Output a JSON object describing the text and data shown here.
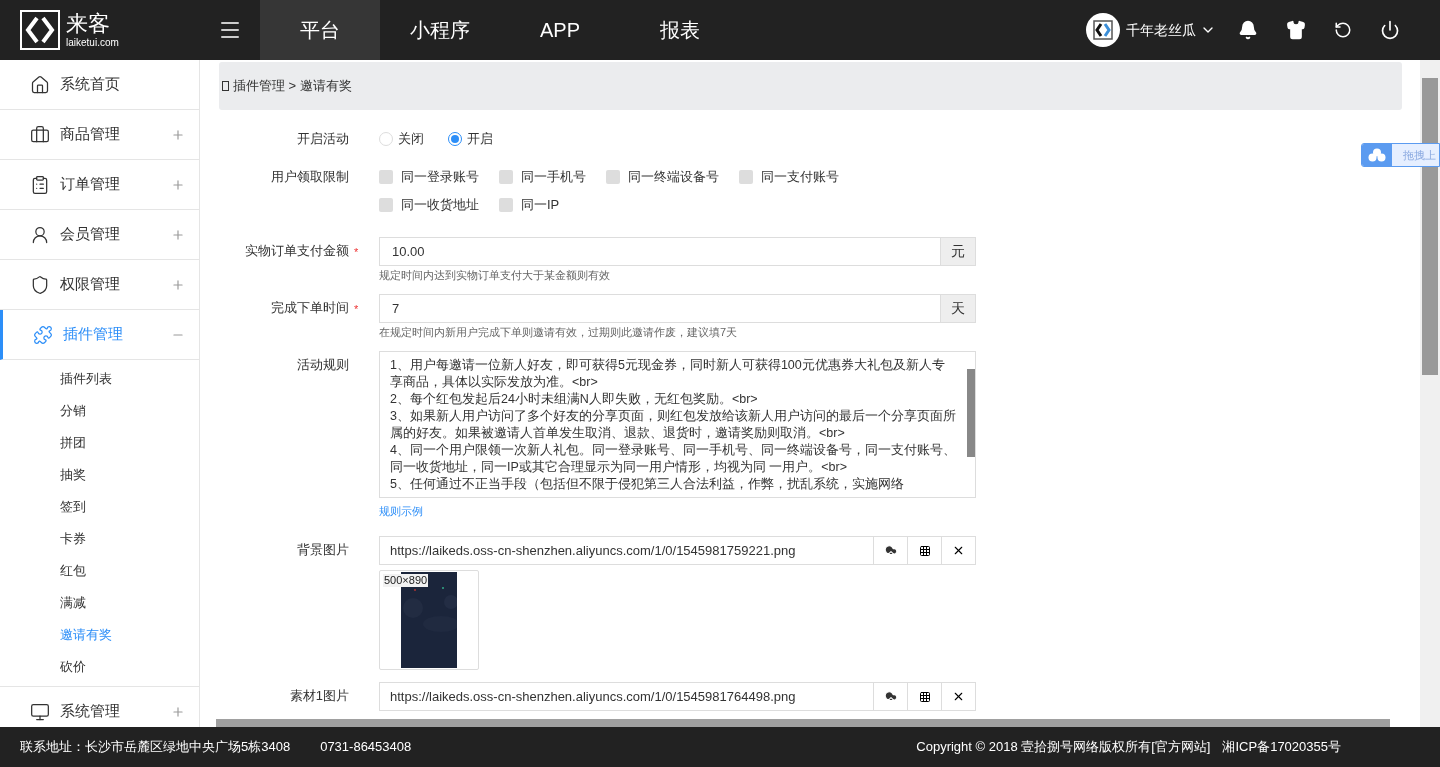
{
  "header": {
    "logo": {
      "name": "来客",
      "domain": "laiketui.com"
    },
    "nav": [
      {
        "label": "平台",
        "selected": true
      },
      {
        "label": "小程序",
        "selected": false
      },
      {
        "label": "APP",
        "selected": false
      },
      {
        "label": "报表",
        "selected": false
      }
    ],
    "user": {
      "name": "千年老丝瓜"
    }
  },
  "sidebar": {
    "items": [
      {
        "label": "系统首页",
        "kind": "link",
        "selected": false
      },
      {
        "label": "商品管理",
        "kind": "group",
        "expanded": false,
        "selected": false
      },
      {
        "label": "订单管理",
        "kind": "group",
        "expanded": false,
        "selected": false
      },
      {
        "label": "会员管理",
        "kind": "group",
        "expanded": false,
        "selected": false
      },
      {
        "label": "权限管理",
        "kind": "group",
        "expanded": false,
        "selected": false
      },
      {
        "label": "插件管理",
        "kind": "group",
        "expanded": true,
        "selected": true,
        "children": [
          {
            "label": "插件列表",
            "selected": false
          },
          {
            "label": "分销",
            "selected": false
          },
          {
            "label": "拼团",
            "selected": false
          },
          {
            "label": "抽奖",
            "selected": false
          },
          {
            "label": "签到",
            "selected": false
          },
          {
            "label": "卡券",
            "selected": false
          },
          {
            "label": "红包",
            "selected": false
          },
          {
            "label": "满减",
            "selected": false
          },
          {
            "label": "邀请有奖",
            "selected": true
          },
          {
            "label": "砍价",
            "selected": false
          }
        ]
      },
      {
        "label": "系统管理",
        "kind": "group",
        "expanded": false,
        "selected": false
      }
    ]
  },
  "breadcrumb": "插件管理 > 邀请有奖",
  "form": [
    {
      "kind": "radio",
      "label": "开启活动",
      "options": [
        {
          "label": "关闭",
          "selected": false
        },
        {
          "label": "开启",
          "selected": true
        }
      ]
    },
    {
      "kind": "checkbox",
      "label": "用户领取限制",
      "options": [
        {
          "label": "同一登录账号",
          "checked": false
        },
        {
          "label": "同一手机号",
          "checked": false
        },
        {
          "label": "同一终端设备号",
          "checked": false
        },
        {
          "label": "同一支付账号",
          "checked": false
        },
        {
          "label": "同一收货地址",
          "checked": false
        },
        {
          "label": "同一IP",
          "checked": false
        }
      ]
    },
    {
      "kind": "input",
      "label": "实物订单支付金额",
      "required_mark": "*",
      "value": "10.00",
      "unit": "元",
      "hint": "规定时间内达到实物订单支付大于某金额则有效"
    },
    {
      "kind": "input",
      "label": "完成下单时间",
      "required_mark": "*",
      "value": "7",
      "unit": "天",
      "hint": "在规定时间内新用户完成下单则邀请有效，过期则此邀请作废，建议填7天"
    },
    {
      "kind": "textarea",
      "label": "活动规则",
      "value": "1、用户每邀请一位新人好友，即可获得5元现金券，同时新人可获得100元优惠券大礼包及新人专享商品，具体以实际发放为准。<br>\n2、每个红包发起后24小时未组满N人即失败，无红包奖励。<br>\n3、如果新人用户访问了多个好友的分享页面，则红包发放给该新人用户访问的最后一个分享页面所属的好友。如果被邀请人首单发生取消、退款、退货时，邀请奖励则取消。<br>\n4、同一个用户限领一次新人礼包。同一登录账号、同一手机号、同一终端设备号，同一支付账号、同一收货地址，同一IP或其它合理显示为同一用户情形，均视为同 一用户。<br>\n5、任何通过不正当手段（包括但不限于侵犯第三人合法利益，作弊，扰乱系统，实施网络",
      "link": "规则示例"
    },
    {
      "label": "背景图片",
      "value": "https://laikeds.oss-cn-shenzhen.aliyuncs.com/1/0/1545981759221.png",
      "preview_size": "500×890"
    },
    {
      "label": "素材1图片",
      "value": "https://laikeds.oss-cn-shenzhen.aliyuncs.com/1/0/1545981764498.png"
    }
  ],
  "float_widget": {
    "label": "拖拽上"
  },
  "footer": {
    "address": "联系地址：长沙市岳麓区绿地中央广场5栋3408",
    "phone": "0731-86453408",
    "copyright": "Copyright © 2018 壹拾捌号网络版权所有[官方网站]",
    "icp": "湘ICP备17020355号"
  }
}
